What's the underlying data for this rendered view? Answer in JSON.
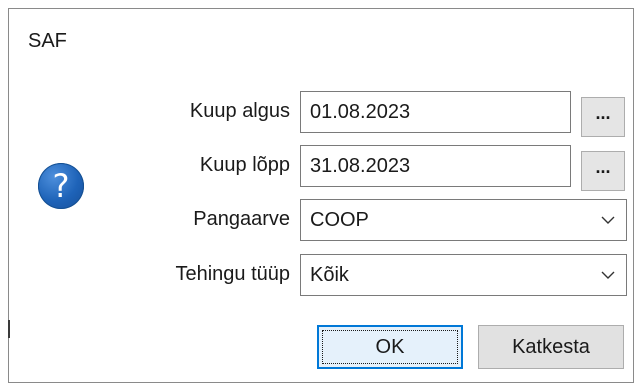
{
  "dialog": {
    "title": "SAF",
    "icon": "question-icon"
  },
  "form": {
    "period_start": {
      "label": "Kuup algus",
      "value": "01.08.2023",
      "picker_label": "..."
    },
    "period_end": {
      "label": "Kuup lõpp",
      "value": "31.08.2023",
      "picker_label": "..."
    },
    "bank_account": {
      "label": "Pangaarve",
      "value": "COOP"
    },
    "transaction_type": {
      "label": "Tehingu tüüp",
      "value": "Kõik"
    }
  },
  "buttons": {
    "ok_label": "OK",
    "cancel_label": "Katkesta"
  },
  "colors": {
    "accent": "#0078d7",
    "icon_blue": "#1e63b8"
  }
}
